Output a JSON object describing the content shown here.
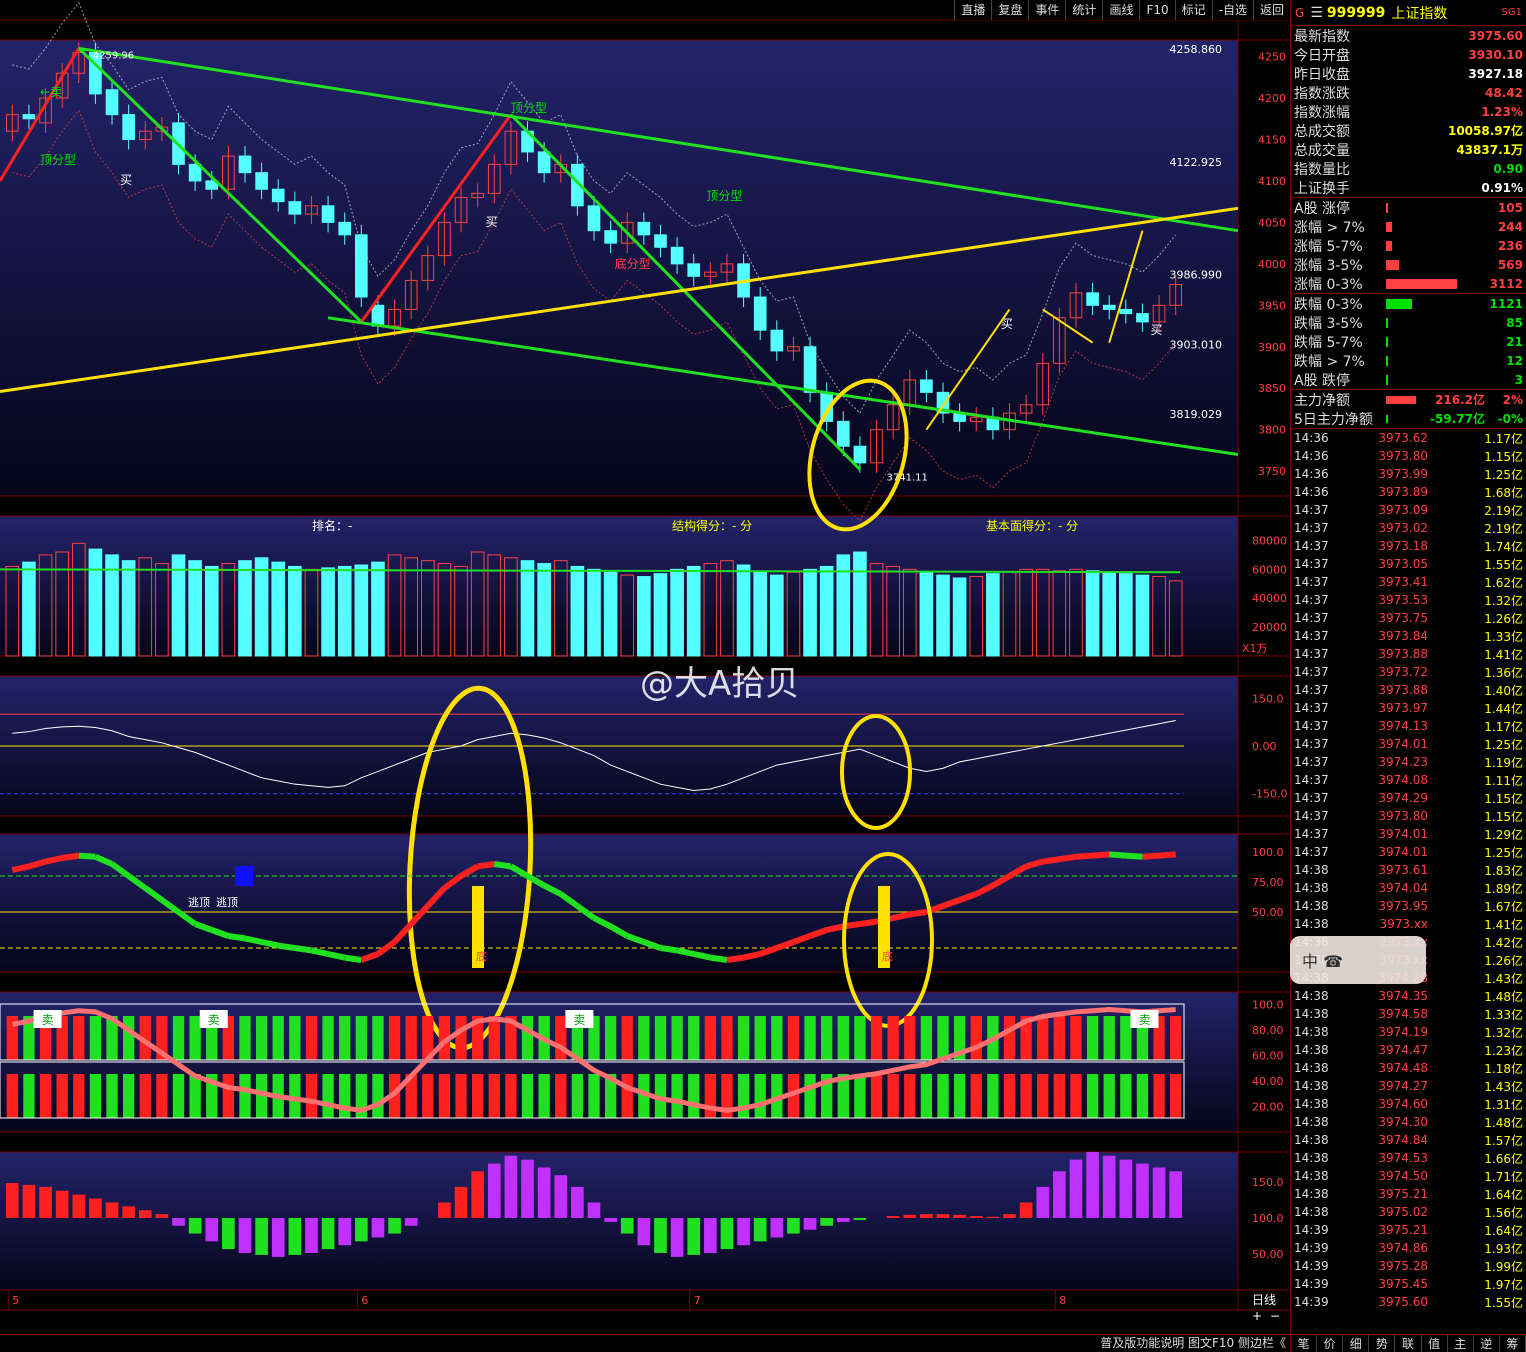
{
  "toolbar": [
    "直播",
    "复盘",
    "事件",
    "统计",
    "画线",
    "F10",
    "标记",
    "-自选",
    "返回"
  ],
  "stock": {
    "g": "G",
    "code": "999999",
    "name": "上证指数",
    "tag": "SG1"
  },
  "quote": [
    {
      "label": "最新指数",
      "value": "3975.60",
      "color": "#ff4040"
    },
    {
      "label": "今日开盘",
      "value": "3930.10",
      "color": "#ff4040"
    },
    {
      "label": "昨日收盘",
      "value": "3927.18",
      "color": "#ffffff"
    },
    {
      "label": "指数涨跌",
      "value": "48.42",
      "color": "#ff4040"
    },
    {
      "label": "指数涨幅",
      "value": "1.23%",
      "color": "#ff4040"
    },
    {
      "label": "总成交额",
      "value": "10058.97亿",
      "color": "#ffff00"
    },
    {
      "label": "总成交量",
      "value": "43837.1万",
      "color": "#ffff00"
    },
    {
      "label": "指数量比",
      "value": "0.90",
      "color": "#00e000"
    },
    {
      "label": "上证换手",
      "value": "0.91%",
      "color": "#ffffff"
    }
  ],
  "breadth_up": [
    {
      "label": "A股 涨停",
      "value": "105",
      "frac": 0.03
    },
    {
      "label": "涨幅 > 7%",
      "value": "244",
      "frac": 0.07
    },
    {
      "label": "涨幅 5-7%",
      "value": "236",
      "frac": 0.07
    },
    {
      "label": "涨幅 3-5%",
      "value": "569",
      "frac": 0.16
    },
    {
      "label": "涨幅 0-3%",
      "value": "3112",
      "frac": 0.88
    }
  ],
  "breadth_down": [
    {
      "label": "跌幅 0-3%",
      "value": "1121",
      "frac": 0.32
    },
    {
      "label": "跌幅 3-5%",
      "value": "85",
      "frac": 0.03
    },
    {
      "label": "跌幅 5-7%",
      "value": "21",
      "frac": 0.01
    },
    {
      "label": "跌幅 > 7%",
      "value": "12",
      "frac": 0.01
    },
    {
      "label": "A股 跌停",
      "value": "3",
      "frac": 0.005
    }
  ],
  "flows": [
    {
      "label": "主力净额",
      "value": "216.2亿",
      "pct": "2%",
      "color": "#ff4040",
      "frac": 0.3
    },
    {
      "label": "5日主力净额",
      "value": "-59.77亿",
      "pct": "-0%",
      "color": "#00e000",
      "frac": 0.0
    }
  ],
  "ticks": [
    [
      "14:36",
      "3973.62",
      "1.17亿"
    ],
    [
      "14:36",
      "3973.80",
      "1.15亿"
    ],
    [
      "14:36",
      "3973.99",
      "1.25亿"
    ],
    [
      "14:36",
      "3973.89",
      "1.68亿"
    ],
    [
      "14:37",
      "3973.09",
      "2.19亿"
    ],
    [
      "14:37",
      "3973.02",
      "2.19亿"
    ],
    [
      "14:37",
      "3973.18",
      "1.74亿"
    ],
    [
      "14:37",
      "3973.05",
      "1.55亿"
    ],
    [
      "14:37",
      "3973.41",
      "1.62亿"
    ],
    [
      "14:37",
      "3973.53",
      "1.32亿"
    ],
    [
      "14:37",
      "3973.75",
      "1.26亿"
    ],
    [
      "14:37",
      "3973.84",
      "1.33亿"
    ],
    [
      "14:37",
      "3973.88",
      "1.41亿"
    ],
    [
      "14:37",
      "3973.72",
      "1.36亿"
    ],
    [
      "14:37",
      "3973.88",
      "1.40亿"
    ],
    [
      "14:37",
      "3973.97",
      "1.44亿"
    ],
    [
      "14:37",
      "3974.13",
      "1.17亿"
    ],
    [
      "14:37",
      "3974.01",
      "1.25亿"
    ],
    [
      "14:37",
      "3974.23",
      "1.19亿"
    ],
    [
      "14:37",
      "3974.08",
      "1.11亿"
    ],
    [
      "14:37",
      "3974.29",
      "1.15亿"
    ],
    [
      "14:37",
      "3973.80",
      "1.15亿"
    ],
    [
      "14:37",
      "3974.01",
      "1.29亿"
    ],
    [
      "14:37",
      "3974.01",
      "1.25亿"
    ],
    [
      "14:38",
      "3973.61",
      "1.83亿"
    ],
    [
      "14:38",
      "3974.04",
      "1.89亿"
    ],
    [
      "14:38",
      "3973.95",
      "1.67亿"
    ],
    [
      "14:38",
      "3973.xx",
      "1.41亿"
    ],
    [
      "14:38",
      "3973.xx",
      "1.42亿"
    ],
    [
      "14:38",
      "3973.xx",
      "1.26亿"
    ],
    [
      "14:38",
      "3974.28",
      "1.43亿"
    ],
    [
      "14:38",
      "3974.35",
      "1.48亿"
    ],
    [
      "14:38",
      "3974.58",
      "1.33亿"
    ],
    [
      "14:38",
      "3974.19",
      "1.32亿"
    ],
    [
      "14:38",
      "3974.47",
      "1.23亿"
    ],
    [
      "14:38",
      "3974.48",
      "1.18亿"
    ],
    [
      "14:38",
      "3974.27",
      "1.43亿"
    ],
    [
      "14:38",
      "3974.60",
      "1.31亿"
    ],
    [
      "14:38",
      "3974.30",
      "1.48亿"
    ],
    [
      "14:38",
      "3974.84",
      "1.57亿"
    ],
    [
      "14:38",
      "3974.53",
      "1.66亿"
    ],
    [
      "14:38",
      "3974.50",
      "1.71亿"
    ],
    [
      "14:38",
      "3975.21",
      "1.64亿"
    ],
    [
      "14:38",
      "3975.02",
      "1.56亿"
    ],
    [
      "14:39",
      "3975.21",
      "1.64亿"
    ],
    [
      "14:39",
      "3974.86",
      "1.93亿"
    ],
    [
      "14:39",
      "3975.28",
      "1.99亿"
    ],
    [
      "14:39",
      "3975.45",
      "1.97亿"
    ],
    [
      "14:39",
      "3975.60",
      "1.55亿"
    ]
  ],
  "bottom_tabs": [
    "笔",
    "价",
    "细",
    "势",
    "联",
    "值",
    "主",
    "逆",
    "筹"
  ],
  "status_right": "普及版功能说明 图文F10 侧边栏《",
  "watermark": "@大A拾贝",
  "badge_text": "中 ☎",
  "period_label": "日线",
  "chart_data": {
    "type": "candlestick",
    "price_axis": [
      "4250",
      "4200",
      "4150",
      "4100",
      "4050",
      "4000",
      "3950",
      "3900",
      "3850",
      "3800",
      "3750"
    ],
    "price_ylim": [
      3720,
      4270
    ],
    "price_labels": [
      {
        "text": "4258.860",
        "y": 4258.86
      },
      {
        "text": "4122.925",
        "y": 4122.925
      },
      {
        "text": "3986.990",
        "y": 3986.99
      },
      {
        "text": "3903.010",
        "y": 3903.01
      },
      {
        "text": "3819.029",
        "y": 3819.029
      }
    ],
    "high_label": "4259.96",
    "low_label": "3741.11",
    "vol_axis": [
      "80000",
      "60000",
      "40000",
      "20000"
    ],
    "vol_unit": "X1万",
    "score_bar": {
      "rank": "排名：-",
      "struct": "结构得分：- 分",
      "fund": "基本面得分：- 分"
    },
    "osc1_axis": [
      "150.0",
      "0.00",
      "-150.0"
    ],
    "osc2_axis": [
      "100.0",
      "75.00",
      "50.00"
    ],
    "osc3_axis": [
      "100.0",
      "80.00",
      "60.00",
      "40.00",
      "20.00"
    ],
    "osc4_axis": [
      "150.0",
      "100.0",
      "50.00"
    ],
    "x_labels": [
      {
        "text": "5",
        "i": 0
      },
      {
        "text": "6",
        "i": 21
      },
      {
        "text": "7",
        "i": 41
      },
      {
        "text": "8",
        "i": 63
      }
    ],
    "annotations": {
      "sell": "卖",
      "buy": "买",
      "top": "顶分型",
      "bottom": "底分型",
      "escape": "逃顶",
      "bottom_char": "底",
      "sell_arrow": "←卖"
    },
    "closes": [
      4180,
      4175,
      4200,
      4230,
      4255,
      4205,
      4180,
      4150,
      4160,
      4165,
      4120,
      4100,
      4090,
      4130,
      4110,
      4090,
      4075,
      4060,
      4070,
      4050,
      4035,
      3960,
      3925,
      3945,
      3980,
      4010,
      4050,
      4080,
      4085,
      4120,
      4160,
      4135,
      4110,
      4120,
      4070,
      4040,
      4025,
      4050,
      4035,
      4020,
      4000,
      3985,
      3990,
      4000,
      3960,
      3920,
      3895,
      3900,
      3845,
      3810,
      3780,
      3760,
      3800,
      3830,
      3860,
      3845,
      3820,
      3810,
      3815,
      3800,
      3820,
      3830,
      3880,
      3935,
      3965,
      3950,
      3945,
      3940,
      3930,
      3950,
      3975
    ],
    "opens": [
      4160,
      4180,
      4170,
      4200,
      4230,
      4255,
      4210,
      4180,
      4150,
      4160,
      4170,
      4120,
      4100,
      4090,
      4130,
      4110,
      4090,
      4075,
      4060,
      4070,
      4050,
      4035,
      3950,
      3925,
      3945,
      3980,
      4010,
      4050,
      4080,
      4085,
      4120,
      4160,
      4135,
      4110,
      4120,
      4070,
      4040,
      4025,
      4050,
      4035,
      4020,
      4000,
      3985,
      3990,
      4000,
      3960,
      3920,
      3895,
      3900,
      3845,
      3810,
      3780,
      3760,
      3800,
      3830,
      3860,
      3845,
      3820,
      3810,
      3815,
      3800,
      3820,
      3830,
      3880,
      3935,
      3965,
      3950,
      3945,
      3940,
      3930,
      3950
    ],
    "volume": [
      62000,
      65000,
      70000,
      72000,
      78000,
      74000,
      70000,
      66000,
      68000,
      64000,
      70000,
      66000,
      62000,
      64000,
      66000,
      68000,
      65000,
      62000,
      60000,
      61000,
      62000,
      63000,
      65000,
      70000,
      68000,
      66000,
      64000,
      62000,
      72000,
      70000,
      68000,
      66000,
      64000,
      66000,
      62000,
      60000,
      58000,
      56000,
      55000,
      57000,
      60000,
      62000,
      64000,
      66000,
      63000,
      58000,
      56000,
      58000,
      60000,
      62000,
      70000,
      72000,
      64000,
      62000,
      60000,
      58000,
      56000,
      54000,
      55000,
      57000,
      58000,
      60000,
      60000,
      59000,
      60000,
      59000,
      58000,
      57000,
      56000,
      55000,
      52000
    ],
    "wr": [
      40,
      45,
      55,
      60,
      62,
      58,
      48,
      30,
      20,
      10,
      -5,
      -20,
      -40,
      -60,
      -80,
      -100,
      -110,
      -120,
      -125,
      -130,
      -125,
      -100,
      -80,
      -60,
      -40,
      -20,
      -10,
      0,
      20,
      30,
      40,
      35,
      25,
      10,
      -10,
      -30,
      -60,
      -80,
      -100,
      -120,
      -130,
      -140,
      -135,
      -120,
      -100,
      -80,
      -60,
      -50,
      -40,
      -30,
      -20,
      -10,
      -30,
      -50,
      -70,
      -80,
      -70,
      -50,
      -40,
      -30,
      -20,
      -10,
      0,
      10,
      20,
      30,
      40,
      50,
      60,
      70,
      80
    ],
    "kdj": [
      85,
      88,
      92,
      95,
      97,
      96,
      90,
      80,
      70,
      60,
      50,
      40,
      35,
      30,
      28,
      25,
      22,
      20,
      18,
      15,
      12,
      10,
      15,
      25,
      40,
      55,
      70,
      80,
      88,
      90,
      88,
      80,
      72,
      65,
      55,
      45,
      38,
      30,
      25,
      20,
      18,
      15,
      12,
      10,
      12,
      15,
      20,
      25,
      30,
      35,
      38,
      40,
      42,
      45,
      48,
      50,
      55,
      60,
      65,
      72,
      80,
      88,
      92,
      94,
      96,
      97,
      98,
      97,
      96,
      97,
      98
    ],
    "macd": [
      90,
      85,
      80,
      70,
      60,
      50,
      40,
      30,
      20,
      10,
      -20,
      -40,
      -60,
      -80,
      -90,
      -95,
      -100,
      -95,
      -90,
      -80,
      -70,
      -60,
      -50,
      -40,
      -20,
      0,
      40,
      80,
      120,
      140,
      160,
      150,
      130,
      110,
      80,
      40,
      -10,
      -40,
      -70,
      -90,
      -100,
      -95,
      -90,
      -80,
      -70,
      -60,
      -50,
      -40,
      -30,
      -20,
      -10,
      -5,
      0,
      5,
      8,
      10,
      10,
      8,
      5,
      3,
      10,
      40,
      80,
      120,
      150,
      170,
      160,
      150,
      140,
      130,
      120
    ]
  }
}
